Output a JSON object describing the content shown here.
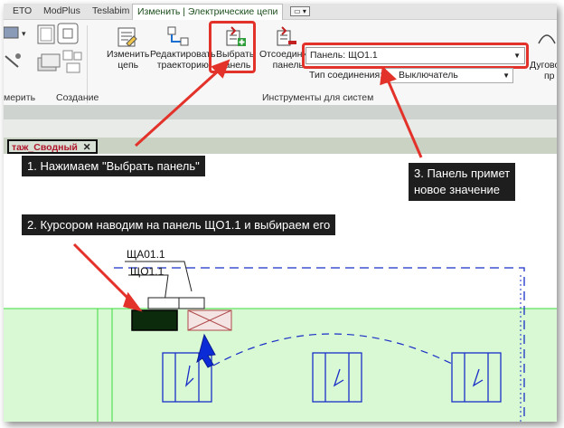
{
  "tabs": [
    {
      "label": "ЕТО",
      "active": false
    },
    {
      "label": "ModPlus",
      "active": false
    },
    {
      "label": "Teslabim",
      "active": false
    },
    {
      "label": "Изменить | Электрические цепи",
      "active": true
    }
  ],
  "ribbon": {
    "buttons": {
      "edit_chain": {
        "line1": "Изменить",
        "line2": "цепь"
      },
      "edit_path": {
        "line1": "Редактировать",
        "line2": "траекторию"
      },
      "select_panel": {
        "line1": "Выбрать",
        "line2": "панель"
      },
      "disconnect_panel": {
        "line1": "Отсоединить",
        "line2": "панель"
      },
      "arc": {
        "line1": "Дугово",
        "line2": "пр"
      }
    },
    "groups": {
      "measure": "мерить",
      "create": "Создание",
      "system_tools": "Инструменты для систем"
    },
    "panel_field": {
      "label": "Панель:",
      "value": "ЩО1.1"
    },
    "connection_type": {
      "label": "Тип соединения:",
      "value": "Выключатель"
    }
  },
  "view_tab": {
    "label": "таж_Сводный",
    "close": "✕"
  },
  "callouts": {
    "step1": "1. Нажимаем \"Выбрать панель\"",
    "step2": "2. Курсором наводим на панель ЩО1.1 и выбираем его",
    "step3_line1": "3. Панель примет",
    "step3_line2": "новое значение"
  },
  "drawing": {
    "label_a": "ЩА01.1",
    "label_b": "ЩО1.1"
  },
  "colors": {
    "accent_red": "#e3322a",
    "cad_blue": "#1a2fc8",
    "panel_dark": "#0c2a0c",
    "green_zone": "#d9f8d4"
  }
}
